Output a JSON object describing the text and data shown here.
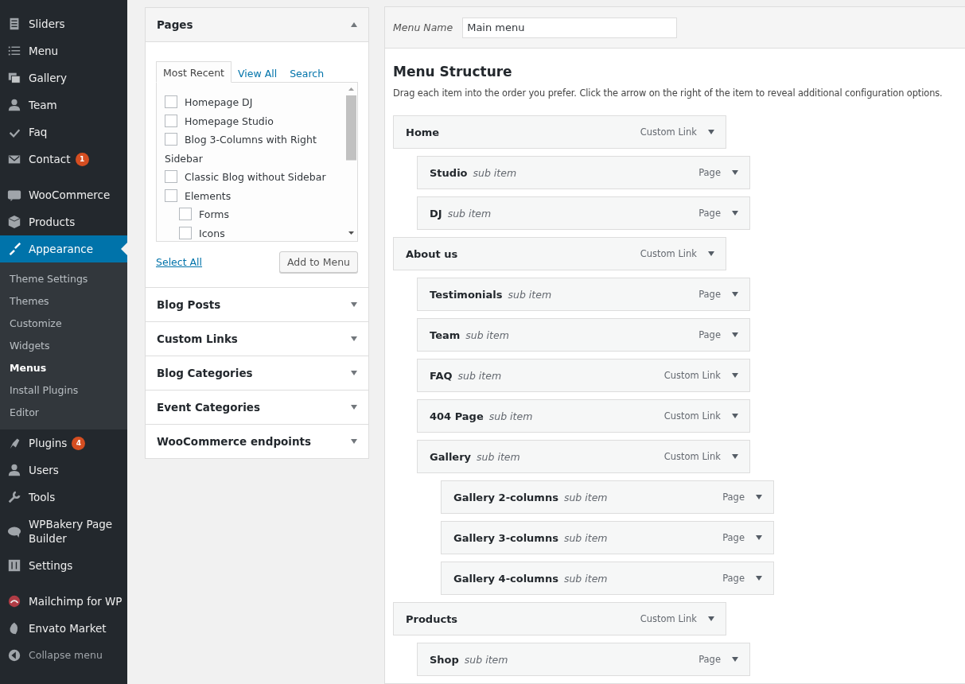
{
  "sidebar": {
    "groups": [
      [
        {
          "label": "Sliders",
          "selected": false
        },
        {
          "label": "Menu",
          "selected": false
        },
        {
          "label": "Gallery",
          "selected": false
        },
        {
          "label": "Team",
          "selected": false
        },
        {
          "label": "Faq",
          "selected": false
        },
        {
          "label": "Contact",
          "selected": false,
          "badge": "1"
        }
      ],
      [
        {
          "label": "WooCommerce",
          "selected": false
        },
        {
          "label": "Products",
          "selected": false
        },
        {
          "label": "Appearance",
          "selected": true,
          "submenu": [
            {
              "label": "Theme Settings",
              "selected": false
            },
            {
              "label": "Themes",
              "selected": false
            },
            {
              "label": "Customize",
              "selected": false
            },
            {
              "label": "Widgets",
              "selected": false
            },
            {
              "label": "Menus",
              "selected": true
            },
            {
              "label": "Install Plugins",
              "selected": false
            },
            {
              "label": "Editor",
              "selected": false
            }
          ]
        },
        {
          "label": "Plugins",
          "selected": false,
          "badge": "4"
        },
        {
          "label": "Users",
          "selected": false
        },
        {
          "label": "Tools",
          "selected": false
        },
        {
          "label": "WPBakery Page Builder",
          "selected": false
        },
        {
          "label": "Settings",
          "selected": false
        }
      ],
      [
        {
          "label": "Mailchimp for WP",
          "selected": false
        },
        {
          "label": "Envato Market",
          "selected": false
        },
        {
          "label": "Collapse menu",
          "selected": false,
          "kind": "collapse"
        }
      ]
    ]
  },
  "add_panels": [
    {
      "title": "Pages",
      "expanded": true,
      "tabs": [
        {
          "label": "Most Recent",
          "selected": true
        },
        {
          "label": "View All",
          "selected": false
        },
        {
          "label": "Search",
          "selected": false
        }
      ],
      "items": [
        {
          "label": "Homepage DJ",
          "checked": false
        },
        {
          "label": "Homepage Studio",
          "checked": false
        },
        {
          "label": "Blog 3-Columns with Right Sidebar",
          "checked": false
        },
        {
          "label": "Classic Blog without Sidebar",
          "checked": false
        },
        {
          "label": "Elements",
          "checked": false,
          "children": [
            {
              "label": "Forms",
              "checked": false
            },
            {
              "label": "Icons",
              "checked": false
            }
          ]
        }
      ],
      "select_all": "Select All",
      "add_button": "Add to Menu"
    },
    {
      "title": "Blog Posts",
      "expanded": false
    },
    {
      "title": "Custom Links",
      "expanded": false
    },
    {
      "title": "Blog Categories",
      "expanded": false
    },
    {
      "title": "Event Categories",
      "expanded": false
    },
    {
      "title": "WooCommerce endpoints",
      "expanded": false
    }
  ],
  "menu_name": {
    "label": "Menu Name",
    "value": "Main menu"
  },
  "menu_structure": {
    "title": "Menu Structure",
    "description": "Drag each item into the order you prefer. Click the arrow on the right of the item to reveal additional configuration options.",
    "items": [
      {
        "title": "Home",
        "type": "Custom Link",
        "children": [
          {
            "title": "Studio",
            "note": "sub item",
            "type": "Page"
          },
          {
            "title": "DJ",
            "note": "sub item",
            "type": "Page"
          }
        ]
      },
      {
        "title": "About us",
        "type": "Custom Link",
        "children": [
          {
            "title": "Testimonials",
            "note": "sub item",
            "type": "Page"
          },
          {
            "title": "Team",
            "note": "sub item",
            "type": "Page"
          },
          {
            "title": "FAQ",
            "note": "sub item",
            "type": "Custom Link"
          },
          {
            "title": "404 Page",
            "note": "sub item",
            "type": "Custom Link"
          },
          {
            "title": "Gallery",
            "note": "sub item",
            "type": "Custom Link",
            "children": [
              {
                "title": "Gallery 2-columns",
                "note": "sub item",
                "type": "Page"
              },
              {
                "title": "Gallery 3-columns",
                "note": "sub item",
                "type": "Page"
              },
              {
                "title": "Gallery 4-columns",
                "note": "sub item",
                "type": "Page"
              }
            ]
          }
        ]
      },
      {
        "title": "Products",
        "type": "Custom Link",
        "children": [
          {
            "title": "Shop",
            "note": "sub item",
            "type": "Page"
          }
        ]
      }
    ]
  }
}
